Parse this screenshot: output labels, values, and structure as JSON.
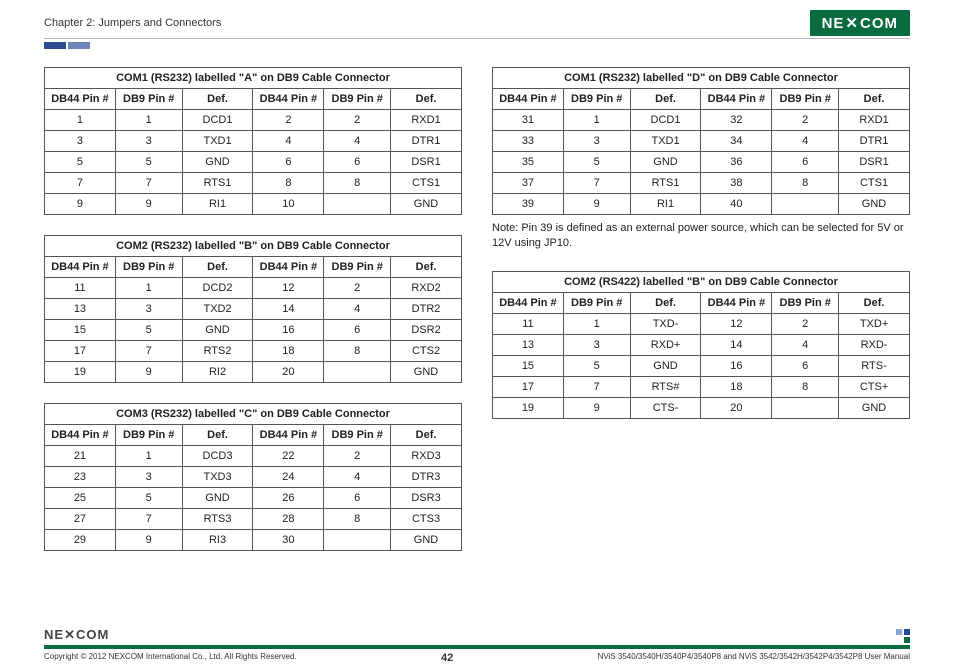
{
  "chapter": "Chapter 2: Jumpers and Connectors",
  "logo_text": "NE COM",
  "blue_blocks": true,
  "colheads": {
    "db44": "DB44 Pin #",
    "db9": "DB9 Pin #",
    "def": "Def."
  },
  "tables_left": [
    {
      "title": "COM1 (RS232) labelled \"A\" on DB9 Cable Connector",
      "rows": [
        [
          "1",
          "1",
          "DCD1",
          "2",
          "2",
          "RXD1"
        ],
        [
          "3",
          "3",
          "TXD1",
          "4",
          "4",
          "DTR1"
        ],
        [
          "5",
          "5",
          "GND",
          "6",
          "6",
          "DSR1"
        ],
        [
          "7",
          "7",
          "RTS1",
          "8",
          "8",
          "CTS1"
        ],
        [
          "9",
          "9",
          "RI1",
          "10",
          "",
          "GND"
        ]
      ]
    },
    {
      "title": "COM2 (RS232) labelled \"B\" on DB9 Cable Connector",
      "rows": [
        [
          "11",
          "1",
          "DCD2",
          "12",
          "2",
          "RXD2"
        ],
        [
          "13",
          "3",
          "TXD2",
          "14",
          "4",
          "DTR2"
        ],
        [
          "15",
          "5",
          "GND",
          "16",
          "6",
          "DSR2"
        ],
        [
          "17",
          "7",
          "RTS2",
          "18",
          "8",
          "CTS2"
        ],
        [
          "19",
          "9",
          "RI2",
          "20",
          "",
          "GND"
        ]
      ]
    },
    {
      "title": "COM3 (RS232) labelled \"C\" on DB9 Cable Connector",
      "rows": [
        [
          "21",
          "1",
          "DCD3",
          "22",
          "2",
          "RXD3"
        ],
        [
          "23",
          "3",
          "TXD3",
          "24",
          "4",
          "DTR3"
        ],
        [
          "25",
          "5",
          "GND",
          "26",
          "6",
          "DSR3"
        ],
        [
          "27",
          "7",
          "RTS3",
          "28",
          "8",
          "CTS3"
        ],
        [
          "29",
          "9",
          "RI3",
          "30",
          "",
          "GND"
        ]
      ]
    }
  ],
  "tables_right": [
    {
      "title": "COM1 (RS232) labelled \"D\" on DB9 Cable Connector",
      "rows": [
        [
          "31",
          "1",
          "DCD1",
          "32",
          "2",
          "RXD1"
        ],
        [
          "33",
          "3",
          "TXD1",
          "34",
          "4",
          "DTR1"
        ],
        [
          "35",
          "5",
          "GND",
          "36",
          "6",
          "DSR1"
        ],
        [
          "37",
          "7",
          "RTS1",
          "38",
          "8",
          "CTS1"
        ],
        [
          "39",
          "9",
          "RI1",
          "40",
          "",
          "GND"
        ]
      ]
    },
    {
      "title": "COM2 (RS422) labelled \"B\" on DB9 Cable Connector",
      "rows": [
        [
          "11",
          "1",
          "TXD-",
          "12",
          "2",
          "TXD+"
        ],
        [
          "13",
          "3",
          "RXD+",
          "14",
          "4",
          "RXD-"
        ],
        [
          "15",
          "5",
          "GND",
          "16",
          "6",
          "RTS-"
        ],
        [
          "17",
          "7",
          "RTS#",
          "18",
          "8",
          "CTS+"
        ],
        [
          "19",
          "9",
          "CTS-",
          "20",
          "",
          "GND"
        ]
      ]
    }
  ],
  "note_right_0": "Note: Pin 39 is defined as an external power source, which can be selected for 5V or 12V using JP10.",
  "footer": {
    "copyright": "Copyright © 2012 NEXCOM International Co., Ltd. All Rights Reserved.",
    "page": "42",
    "manual": "NViS 3540/3540H/3540P4/3540P8 and NViS 3542/3542H/3542P4/3542P8 User Manual"
  }
}
